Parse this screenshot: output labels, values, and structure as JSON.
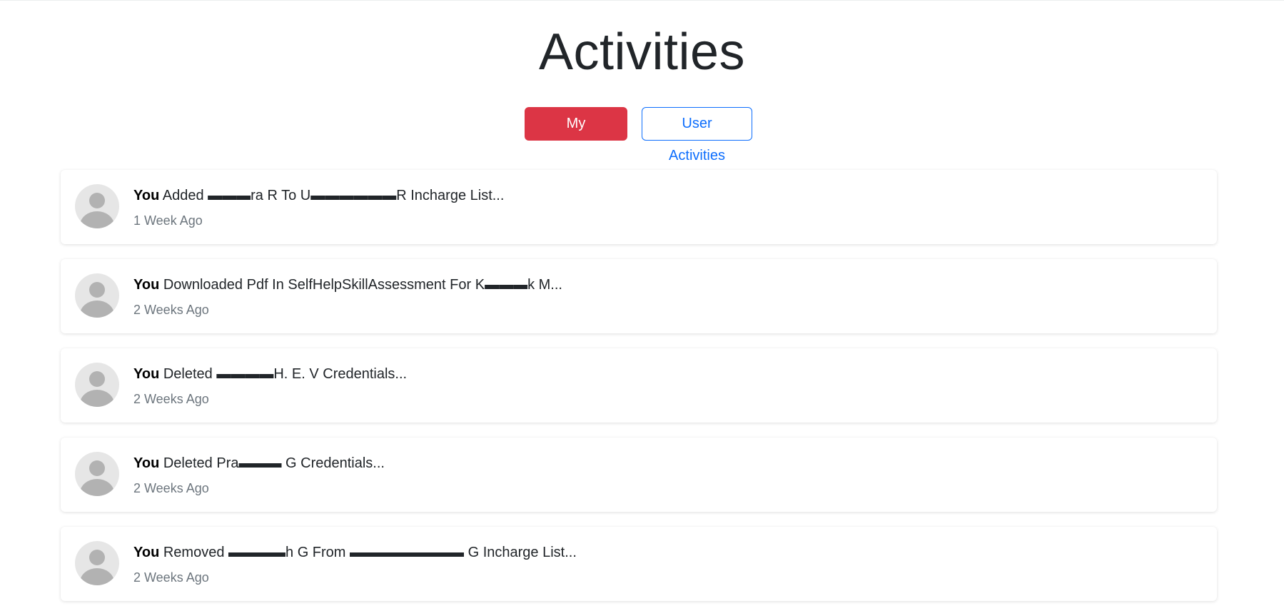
{
  "page": {
    "title": "Activities"
  },
  "tabs": {
    "my_activities": "My Activities",
    "user_activities": "User Activities"
  },
  "activities": [
    {
      "actor": "You",
      "text": "Added ▬▬▬ra R To U▬▬▬▬▬▬R Incharge List...",
      "time": "1 Week Ago"
    },
    {
      "actor": "You",
      "text": "Downloaded Pdf In SelfHelpSkillAssessment For K▬▬▬k M...",
      "time": "2 Weeks Ago"
    },
    {
      "actor": "You",
      "text": "Deleted ▬▬▬▬H. E. V Credentials...",
      "time": "2 Weeks Ago"
    },
    {
      "actor": "You",
      "text": "Deleted Pra▬▬▬ G Credentials...",
      "time": "2 Weeks Ago"
    },
    {
      "actor": "You",
      "text": "Removed ▬▬▬▬h G From ▬▬▬▬▬▬▬▬ G Incharge List...",
      "time": "2 Weeks Ago"
    }
  ],
  "colors": {
    "primary_button": "#dc3545",
    "outline_button": "#0d6efd",
    "muted_text": "#6c757d"
  },
  "icons": {
    "avatar": "user-avatar-placeholder-icon"
  }
}
